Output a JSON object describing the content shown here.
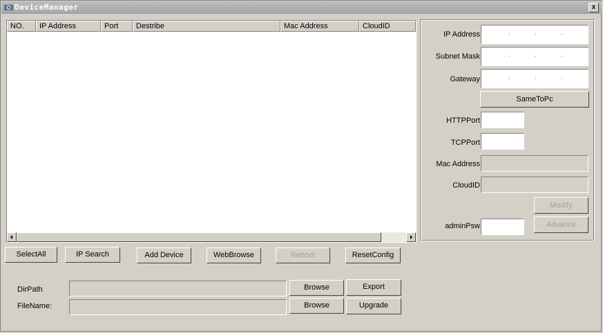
{
  "window": {
    "title": "DeviceManager",
    "close_label": "x"
  },
  "listview": {
    "columns": [
      "NO.",
      "IP Address",
      "Port",
      "Destribe",
      "Mac Address",
      "CloudID"
    ]
  },
  "right_panel": {
    "ip_label": "IP Address",
    "subnet_label": "Subnet Mask",
    "gateway_label": "Gateway",
    "same_to_pc": "SameToPc",
    "http_port_label": "HTTPPort",
    "tcp_port_label": "TCPPort",
    "mac_label": "Mac Address",
    "cloud_label": "CloudID",
    "modify": "Modify",
    "admin_psw_label": "adminPsw",
    "advance": "Advance",
    "ip_dot": "."
  },
  "buttons": {
    "select_all": "SelectAll",
    "ip_search": "IP Search",
    "add_device": "Add Device",
    "web_browse": "WebBrowse",
    "reboot": "Reboot",
    "reset_config": "ResetConfig",
    "browse": "Browse",
    "export": "Export",
    "upgrade": "Upgrade"
  },
  "bottom": {
    "dir_path_label": "DirPath",
    "file_name_label": "FileName:"
  }
}
